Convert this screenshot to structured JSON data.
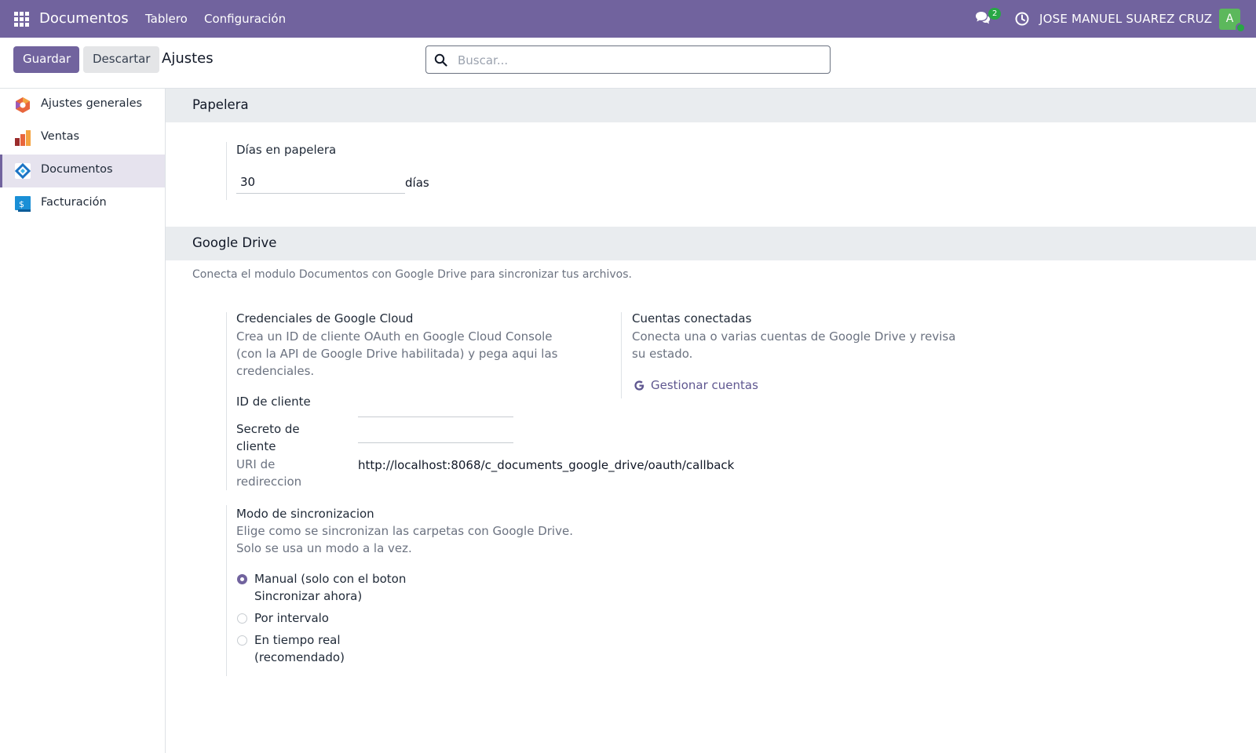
{
  "navbar": {
    "app_name": "Documentos",
    "menu": [
      "Tablero",
      "Configuración"
    ],
    "chat_count": "2",
    "user_name": "JOSE MANUEL SUAREZ CRUZ",
    "avatar_letter": "A"
  },
  "control": {
    "save_label": "Guardar",
    "discard_label": "Descartar",
    "title": "Ajustes",
    "search_placeholder": "Buscar..."
  },
  "sidebar": {
    "items": [
      {
        "label": "Ajustes generales",
        "icon": "settings-app-icon"
      },
      {
        "label": "Ventas",
        "icon": "sales-app-icon"
      },
      {
        "label": "Documentos",
        "icon": "documents-app-icon",
        "active": true
      },
      {
        "label": "Facturación",
        "icon": "invoicing-app-icon"
      }
    ]
  },
  "trash": {
    "title": "Papelera",
    "field_label": "Días en papelera",
    "value": "30",
    "unit": "días"
  },
  "gdrive": {
    "title": "Google Drive",
    "description": "Conecta el modulo Documentos con Google Drive para sincronizar tus archivos.",
    "credentials": {
      "title": "Credenciales de Google Cloud",
      "help_1": "Crea un ID de cliente OAuth en Google Cloud Console",
      "help_2": "(con la API de Google Drive habilitada) y pega aqui las",
      "help_3": "credenciales.",
      "client_id_label": "ID de cliente",
      "client_id_value": "",
      "client_secret_label_1": "Secreto de",
      "client_secret_label_2": "cliente",
      "client_secret_value": "",
      "redirect_label_1": "URI de",
      "redirect_label_2": "redireccion",
      "redirect_value": "http://localhost:8068/c_documents_google_drive/oauth/callback"
    },
    "accounts": {
      "title": "Cuentas conectadas",
      "help_1": "Conecta una o varias cuentas de Google Drive y revisa",
      "help_2": "su estado.",
      "manage_label": "Gestionar cuentas"
    },
    "sync": {
      "title": "Modo de sincronizacion",
      "help_1": "Elige como se sincronizan las carpetas con Google Drive.",
      "help_2": "Solo se usa un modo a la vez.",
      "options": [
        {
          "line1": "Manual (solo con el boton",
          "line2": "Sincronizar ahora)",
          "checked": true
        },
        {
          "line1": "Por intervalo",
          "line2": "",
          "checked": false
        },
        {
          "line1": "En tiempo real",
          "line2": "(recomendado)",
          "checked": false
        }
      ]
    }
  }
}
